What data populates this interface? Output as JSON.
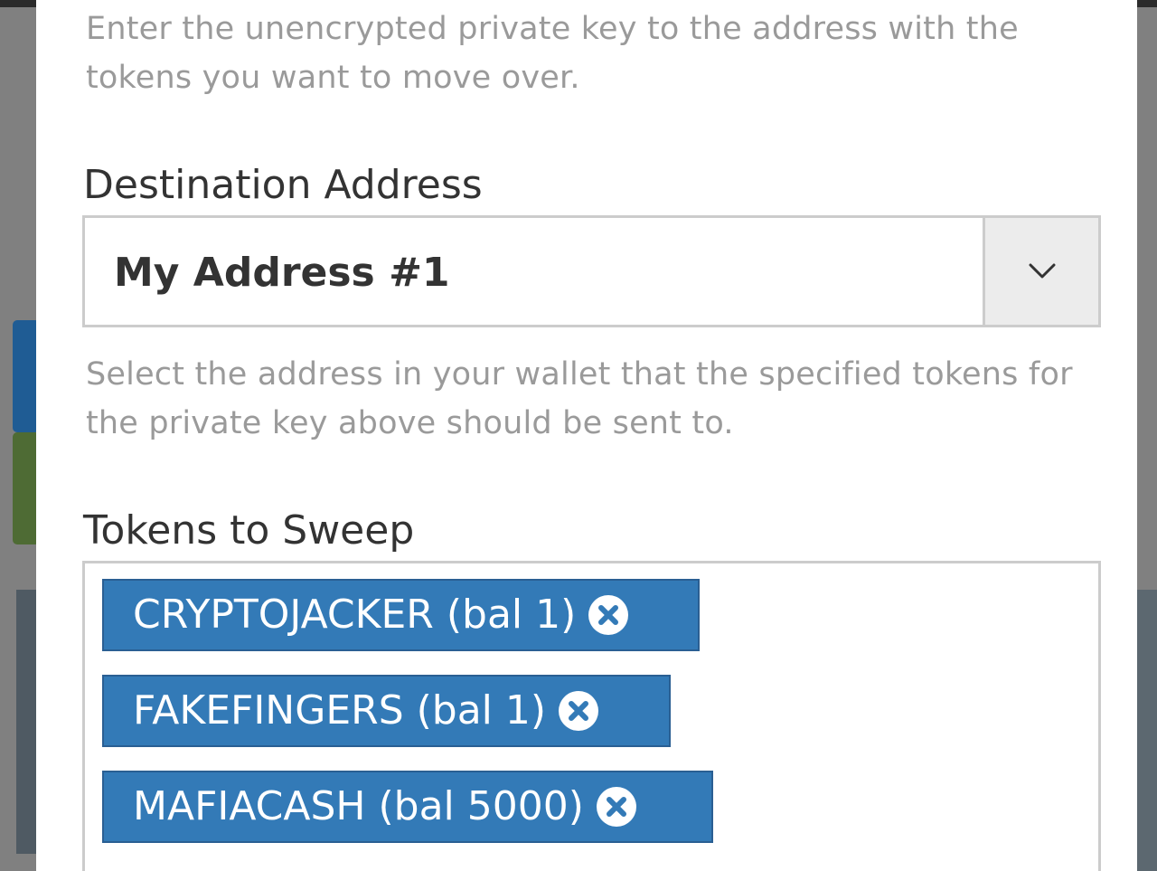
{
  "help": {
    "private_key": "Enter the unencrypted private key to the address with the tokens you want to move over.",
    "destination": "Select the address in your wallet that the specified tokens for the private key above should be sent to."
  },
  "destination": {
    "label": "Destination Address",
    "selected": "My Address #1"
  },
  "tokens": {
    "label": "Tokens to Sweep",
    "items": [
      {
        "label": "CRYPTOJACKER (bal 1)"
      },
      {
        "label": "FAKEFINGERS (bal 1)"
      },
      {
        "label": "MAFIACASH (bal 5000)"
      }
    ]
  },
  "icons": {
    "caret": "chevron-down-icon",
    "remove": "close-circle-icon"
  },
  "colors": {
    "chip": "#337ab7",
    "border": "#cccccc",
    "help_text": "#9a9a9a",
    "label_text": "#333333"
  }
}
